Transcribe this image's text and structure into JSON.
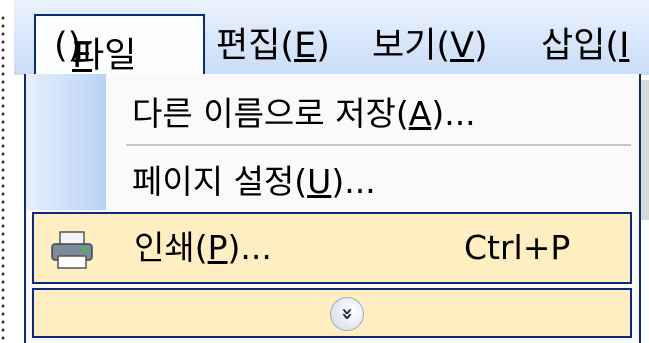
{
  "menubar": {
    "items": [
      {
        "label": "파일",
        "key": "F"
      },
      {
        "label": "편집",
        "key": "E"
      },
      {
        "label": "보기",
        "key": "V"
      },
      {
        "label": "삽입",
        "key": "I"
      }
    ]
  },
  "dropdown": {
    "items": [
      {
        "label": "다른 이름으로 저장",
        "key": "A",
        "suffix": "..."
      },
      {
        "label": "페이지 설정",
        "key": "U",
        "suffix": "..."
      },
      {
        "label": "인쇄",
        "key": "P",
        "suffix": "...",
        "shortcut": "Ctrl+P",
        "icon": "printer-icon"
      }
    ],
    "expand_icon": "double-chevron-down-icon"
  },
  "colors": {
    "menubar_bg": "#c9dcf6",
    "highlight_bg": "#ffeec2",
    "highlight_border": "#0c2a76"
  }
}
